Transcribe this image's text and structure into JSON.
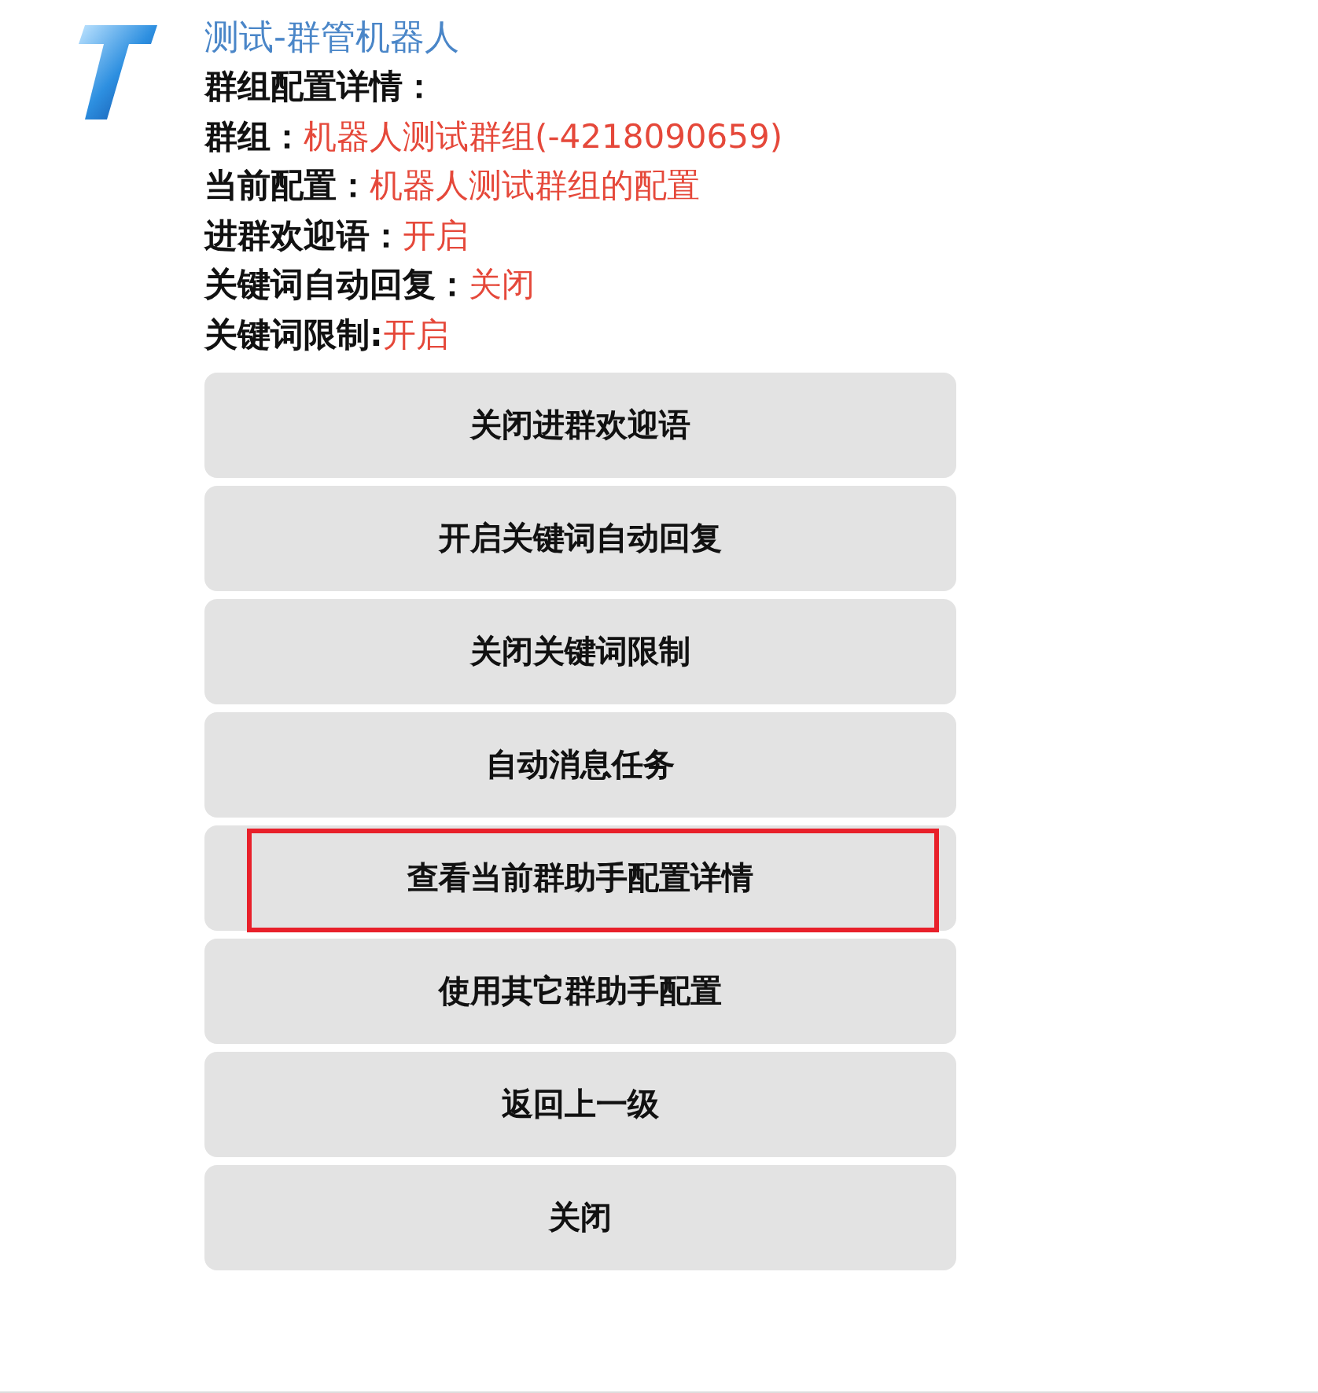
{
  "bot_name": "测试-群管机器人",
  "heading": "群组配置详情：",
  "details": [
    {
      "label": "群组：",
      "value": "机器人测试群组(-4218090659)"
    },
    {
      "label": "当前配置：",
      "value": "机器人测试群组的配置"
    },
    {
      "label": "进群欢迎语：",
      "value": "开启"
    },
    {
      "label": "关键词自动回复：",
      "value": "关闭"
    },
    {
      "label": "关键词限制:",
      "value": "开启"
    }
  ],
  "buttons": [
    {
      "label": "关闭进群欢迎语",
      "highlighted": false
    },
    {
      "label": "开启关键词自动回复",
      "highlighted": false
    },
    {
      "label": "关闭关键词限制",
      "highlighted": false
    },
    {
      "label": "自动消息任务",
      "highlighted": false
    },
    {
      "label": "查看当前群助手配置详情",
      "highlighted": true
    },
    {
      "label": "使用其它群助手配置",
      "highlighted": false
    },
    {
      "label": "返回上一级",
      "highlighted": false
    },
    {
      "label": "关闭",
      "highlighted": false
    }
  ]
}
